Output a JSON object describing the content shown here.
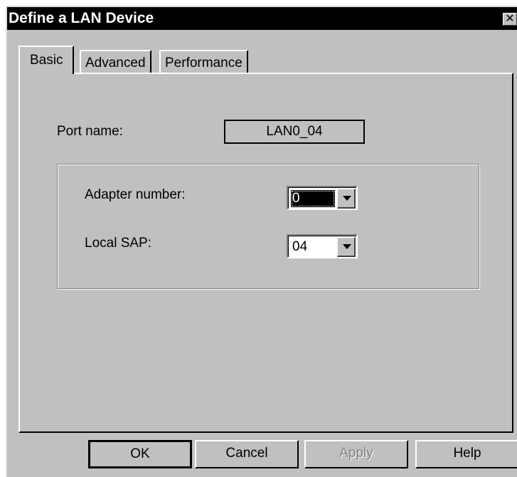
{
  "window": {
    "title": "Define a LAN Device",
    "close_glyph": "✕"
  },
  "tabs": [
    {
      "label": "Basic",
      "active": true
    },
    {
      "label": "Advanced",
      "active": false
    },
    {
      "label": "Performance",
      "active": false
    }
  ],
  "basic": {
    "port_name_label": "Port name:",
    "port_name_value": "LAN0_04",
    "adapter_number_label": "Adapter number:",
    "adapter_number_value": "0",
    "local_sap_label": "Local SAP:",
    "local_sap_value": "04"
  },
  "buttons": {
    "ok": "OK",
    "cancel": "Cancel",
    "apply": "Apply",
    "help": "Help"
  },
  "icons": {
    "close": "close-icon",
    "dropdown": "chevron-down-icon"
  }
}
